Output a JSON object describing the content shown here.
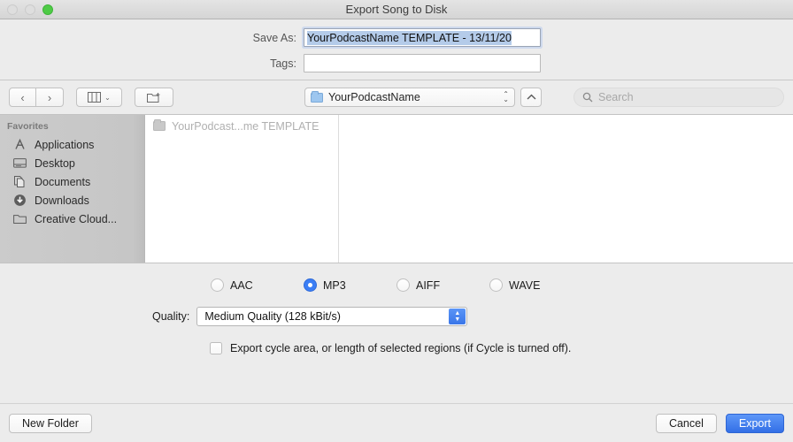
{
  "window": {
    "title": "Export Song to Disk",
    "traffic_lights": [
      {
        "name": "close",
        "state": "disabled"
      },
      {
        "name": "minimize",
        "state": "disabled"
      },
      {
        "name": "zoom",
        "state": "enabled",
        "color": "#4ecb46"
      }
    ]
  },
  "form": {
    "save_as_label": "Save As:",
    "save_as_value": "YourPodcastName TEMPLATE - 13/11/20",
    "tags_label": "Tags:",
    "tags_value": "",
    "tags_placeholder": ""
  },
  "toolbar": {
    "back_icon": "‹",
    "forward_icon": "›",
    "view_icon": "column-view",
    "view_chevron": "⌄",
    "new_folder_icon": "new-folder",
    "path_label": "YourPodcastName",
    "stepper_up": "⌃",
    "stepper_down": "⌄",
    "up_button_icon": "⌃",
    "search_placeholder": "Search"
  },
  "sidebar": {
    "header": "Favorites",
    "items": [
      {
        "label": "Applications",
        "icon": "applications-icon"
      },
      {
        "label": "Desktop",
        "icon": "desktop-icon"
      },
      {
        "label": "Documents",
        "icon": "documents-icon"
      },
      {
        "label": "Downloads",
        "icon": "downloads-icon"
      },
      {
        "label": "Creative Cloud...",
        "icon": "folder-icon"
      }
    ]
  },
  "filelist": {
    "items": [
      {
        "label": "YourPodcast...me TEMPLATE",
        "icon": "folder-icon",
        "dimmed": true
      }
    ]
  },
  "options": {
    "formats": [
      {
        "label": "AAC",
        "selected": false
      },
      {
        "label": "MP3",
        "selected": true
      },
      {
        "label": "AIFF",
        "selected": false
      },
      {
        "label": "WAVE",
        "selected": false
      }
    ],
    "quality_label": "Quality:",
    "quality_value": "Medium Quality (128 kBit/s)",
    "cycle_checkbox_label": "Export cycle area, or length of selected regions (if Cycle is turned off).",
    "cycle_checkbox_checked": false
  },
  "footer": {
    "new_folder_label": "New Folder",
    "cancel_label": "Cancel",
    "export_label": "Export"
  },
  "colors": {
    "accent": "#3b7ef5",
    "selection": "#b4cbe9",
    "window_bg": "#ececec",
    "sidebar_bg": "#c8c8c8"
  }
}
